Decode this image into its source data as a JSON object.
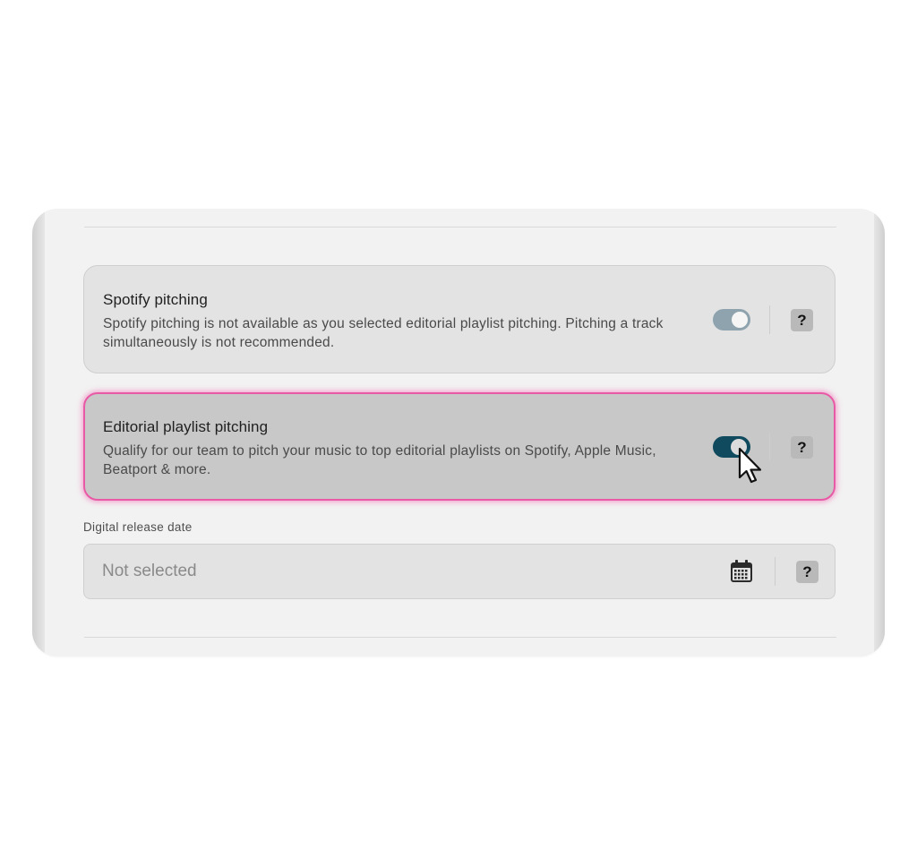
{
  "spotify_pitching": {
    "title": "Spotify pitching",
    "description": "Spotify pitching is not available as you selected editorial playlist pitching. Pitching a track simultaneously is not recommended.",
    "toggle_state": "on-disabled",
    "help_label": "?"
  },
  "editorial_pitching": {
    "title": "Editorial playlist pitching",
    "description": "Qualify for our team to pitch your music to top editorial playlists on Spotify, Apple Music, Beatport & more.",
    "toggle_state": "on",
    "help_label": "?"
  },
  "release_date": {
    "label": "Digital release date",
    "value": "Not selected",
    "icon": "calendar-icon",
    "help_label": "?"
  },
  "colors": {
    "panel_bg": "#f2f2f2",
    "card_bg": "#e3e3e3",
    "active_card_bg": "#c8c8c8",
    "highlight": "#e95aa6",
    "toggle_on": "#0f4a5e",
    "toggle_disabled": "#8ea3ad"
  }
}
